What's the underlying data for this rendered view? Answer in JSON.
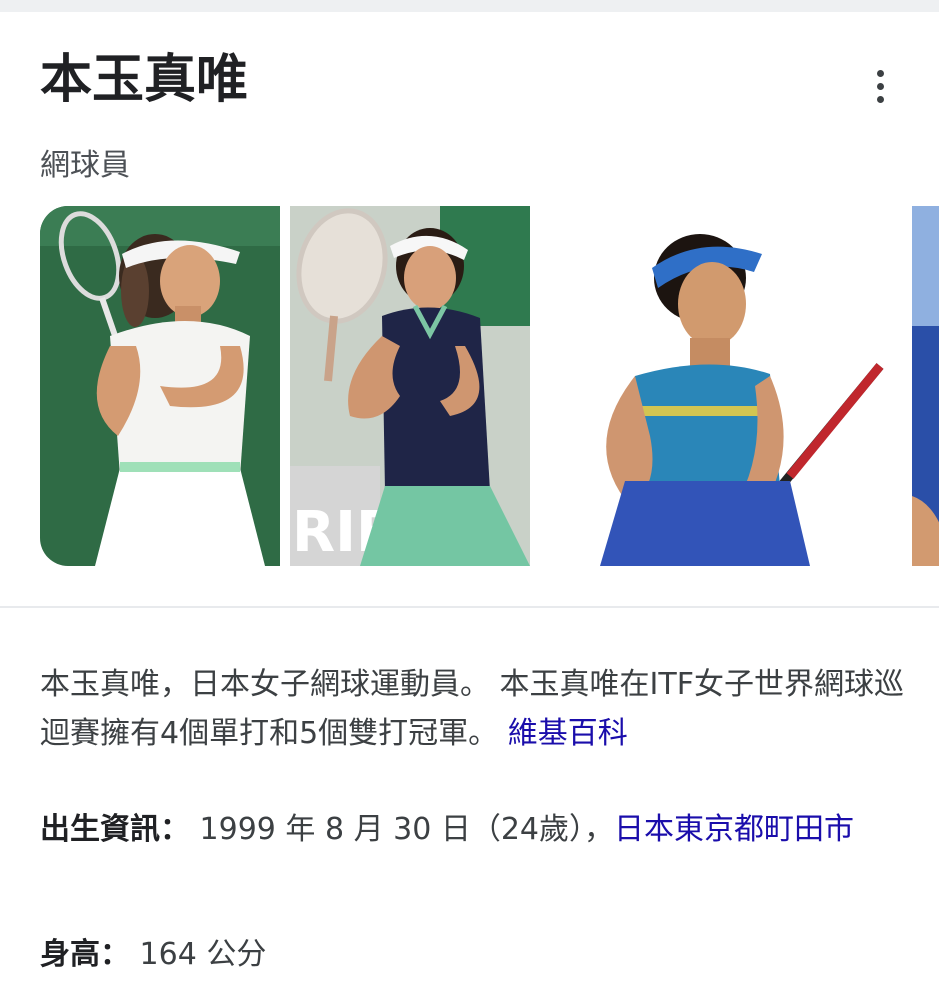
{
  "entity": {
    "title": "本玉真唯",
    "subtitle": "網球員"
  },
  "gallery": {
    "images": [
      {
        "name": "photo-1",
        "outfit_color": "#ffffff",
        "background": "#2f6b45"
      },
      {
        "name": "photo-2",
        "outfit_color": "#1f2547",
        "background": "#c9d1c8"
      },
      {
        "name": "photo-3",
        "outfit_color": "#2a86b8",
        "background": "#ffffff"
      },
      {
        "name": "photo-4",
        "outfit_color": "#1d3f8f",
        "background": "#2a4fa8"
      }
    ]
  },
  "description": {
    "text": "本玉真唯，日本女子網球運動員。 本玉真唯在ITF女子世界網球巡迴賽擁有4個單打和5個雙打冠軍。 ",
    "source_link": "維基百科"
  },
  "facts": {
    "birth": {
      "label": "出生資訊：",
      "value": " 1999 年 8 月 30 日（24歲），",
      "place_link": "日本東京都町田市"
    },
    "height": {
      "label": "身高：",
      "value": " 164 公分"
    }
  },
  "colors": {
    "link": "#1a0dab",
    "title": "#202124",
    "body_text": "#3c4043"
  },
  "icons": {
    "more": "vertical-dots-icon"
  }
}
